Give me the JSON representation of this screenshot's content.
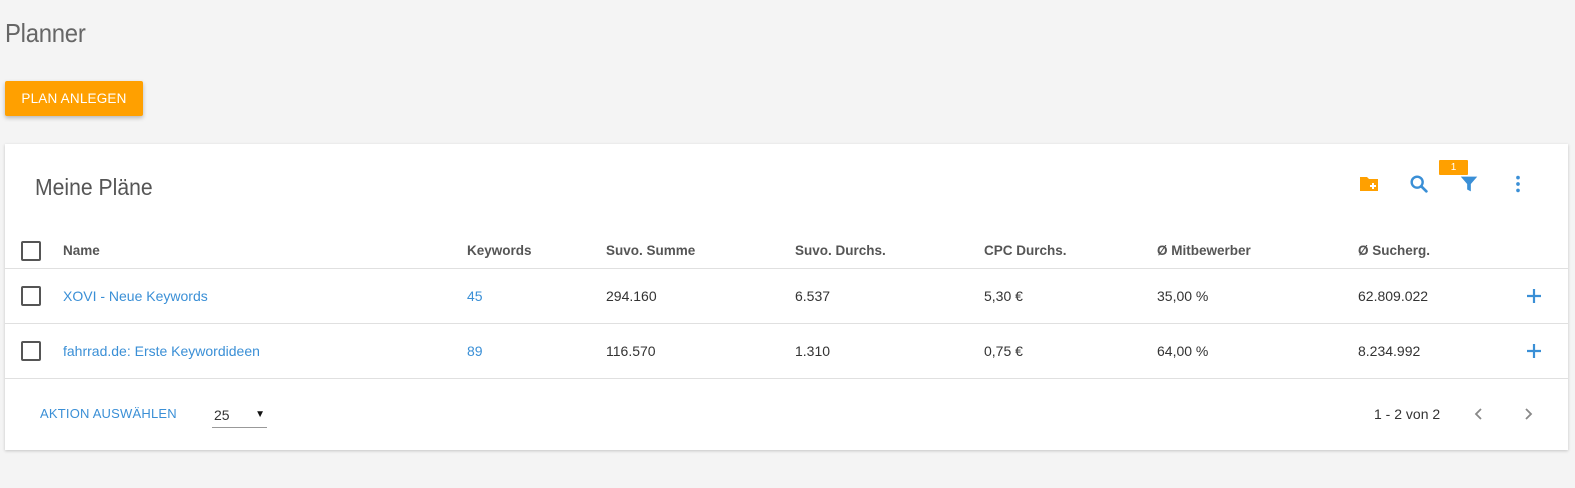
{
  "page": {
    "title": "Planner",
    "create_button_label": "PLAN ANLEGEN"
  },
  "card": {
    "title": "Meine Pläne",
    "toolbar": {
      "icons": [
        "folder-add-icon",
        "search-icon",
        "filter-icon",
        "more-vert-icon"
      ],
      "filter_badge": "1"
    }
  },
  "table": {
    "columns": [
      "Name",
      "Keywords",
      "Suvo. Summe",
      "Suvo. Durchs.",
      "CPC Durchs.",
      "Ø Mitbewerber",
      "Ø Sucherg."
    ],
    "rows": [
      {
        "name": "XOVI - Neue Keywords",
        "keywords": "45",
        "suvo_summe": "294.160",
        "suvo_durchs": "6.537",
        "cpc_durchs": "5,30 €",
        "mitbewerber": "35,00 %",
        "sucherg": "62.809.022"
      },
      {
        "name": "fahrrad.de: Erste Keywordideen",
        "keywords": "89",
        "suvo_summe": "116.570",
        "suvo_durchs": "1.310",
        "cpc_durchs": "0,75 €",
        "mitbewerber": "64,00 %",
        "sucherg": "8.234.992"
      }
    ]
  },
  "footer": {
    "action_label": "AKTION AUSWÄHLEN",
    "page_size": "25",
    "pagination": "1 - 2 von 2"
  },
  "colors": {
    "accent": "#ffa000",
    "link": "#3a8fd6",
    "background": "#f4f4f4"
  }
}
